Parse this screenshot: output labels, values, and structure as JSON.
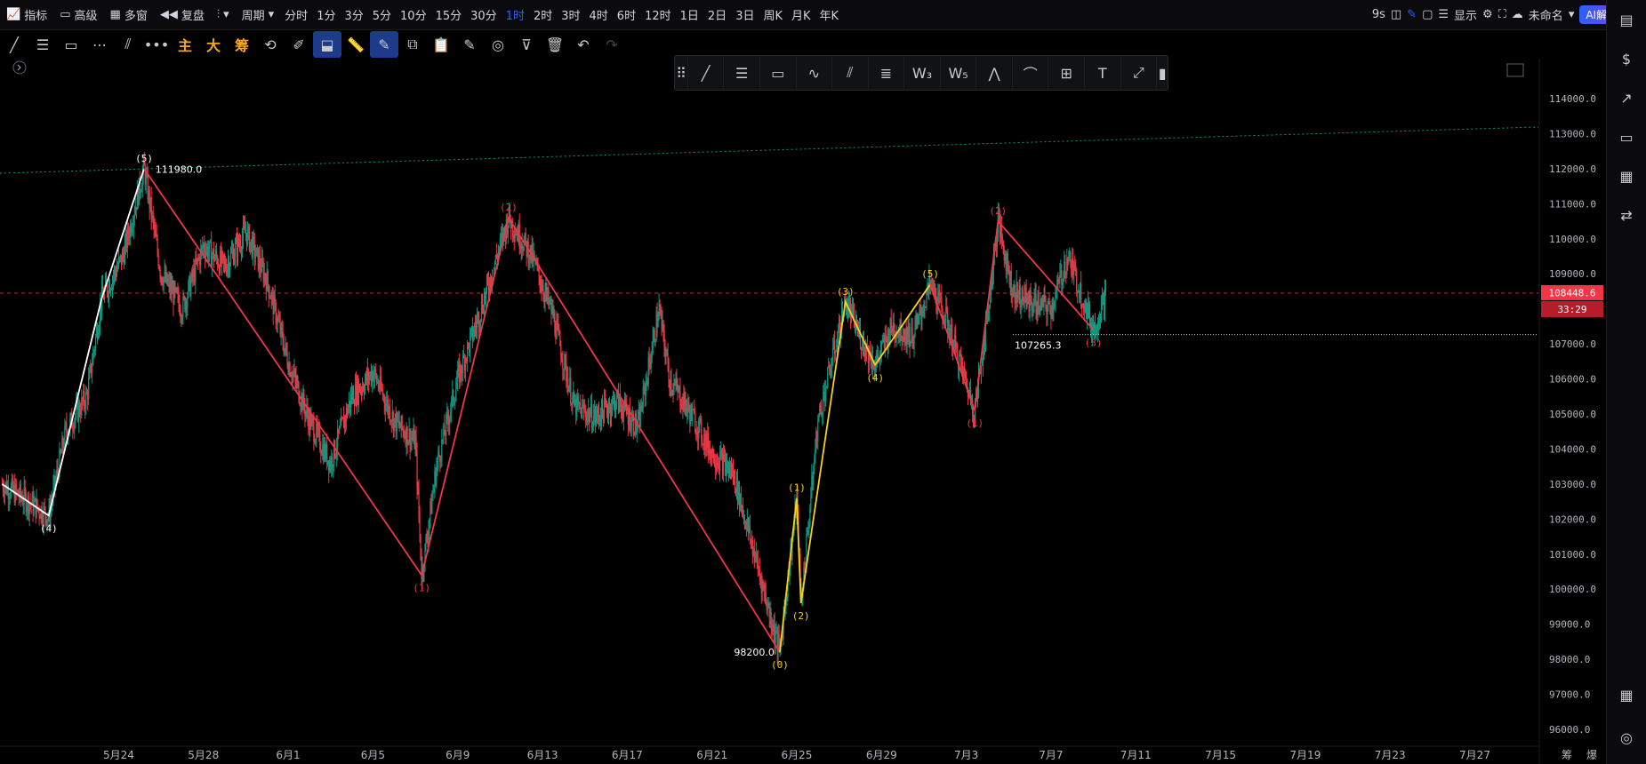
{
  "toolbar": {
    "indicator": "指标",
    "advanced": "高级",
    "multi_window": "多窗",
    "replay": "复盘",
    "period": "周期",
    "intervals": [
      "分时",
      "1分",
      "3分",
      "5分",
      "10分",
      "15分",
      "30分",
      "1时",
      "2时",
      "3时",
      "4时",
      "6时",
      "12时",
      "1日",
      "2日",
      "3日",
      "周K",
      "月K",
      "年K"
    ],
    "active_interval": "1时"
  },
  "top_right": {
    "timer": "9s",
    "display": "显示",
    "doc_name": "未命名",
    "ai": "AI解读"
  },
  "drawing_tools": {
    "main": "主",
    "big": "大",
    "chip": "筹"
  },
  "colors": {
    "up": "#089981",
    "down": "#f23645",
    "wave_red": "#f23645",
    "wave_yellow": "#f5d020",
    "wave_white": "#ffffff",
    "price_line": "#f23645"
  },
  "chart_data": {
    "type": "line",
    "title": "",
    "y_ticks": [
      96000.0,
      97000.0,
      98000.0,
      99000.0,
      100000.0,
      101000.0,
      102000.0,
      103000.0,
      104000.0,
      105000.0,
      106000.0,
      107000.0,
      108000.0,
      109000.0,
      110000.0,
      111000.0,
      112000.0,
      113000.0,
      114000.0
    ],
    "y_tick_labels": [
      "96000.0",
      "97000.0",
      "98000.0",
      "99000.0",
      "100000.0",
      "101000.0",
      "102000.0",
      "103000.0",
      "104000.0",
      "105000.0",
      "106000.0",
      "107000.0",
      "108000.0",
      "109000.0",
      "110000.0",
      "111000.0",
      "112000.0",
      "113000.0",
      "114000.0"
    ],
    "ylim": [
      96000,
      114000
    ],
    "x_ticks": [
      "5月24",
      "5月28",
      "6月1",
      "6月5",
      "6月9",
      "6月13",
      "6月17",
      "6月21",
      "6月25",
      "6月29",
      "7月3",
      "7月7",
      "7月11",
      "7月15",
      "7月19",
      "7月23",
      "7月27"
    ],
    "x_tick_day_index": [
      4,
      8,
      12,
      16,
      20,
      24,
      28,
      32,
      36,
      40,
      44,
      48,
      52,
      56,
      60,
      64,
      68
    ],
    "xlim_day_index": [
      -1.6,
      71.0
    ],
    "x_corner_labels": [
      "筹",
      "爆"
    ],
    "grid": false,
    "current_price": 108448.6,
    "current_price_label": "108448.6",
    "countdown": "33:29",
    "annotations": [
      {
        "text": "111980.0",
        "x": 5.4,
        "y": 111980.0
      },
      {
        "text": "98200.0",
        "x": 35.2,
        "y": 98200.0
      },
      {
        "text": "107265.3",
        "x": 46.2,
        "y": 107265.3
      }
    ],
    "horizontal_levels": [
      {
        "y": 107265.3,
        "from_x": 46.2,
        "style": "dotted"
      }
    ],
    "trend_line": {
      "x": [
        -1.6,
        71.0
      ],
      "y": [
        111870,
        113190
      ]
    },
    "series": [
      {
        "color": "white",
        "points": [
          {
            "x": -1.5,
            "y": 103000
          },
          {
            "x": 0.7,
            "y": 102100
          },
          {
            "x": 3.2,
            "y": 108300
          },
          {
            "x": 5.2,
            "y": 112000
          }
        ],
        "labels": [
          {
            "text": "(4)",
            "x": 0.7,
            "y": 102100,
            "pos": "below"
          },
          {
            "text": "(5)",
            "x": 5.2,
            "y": 112000,
            "pos": "above"
          }
        ]
      },
      {
        "color": "red",
        "points": [
          {
            "x": 5.2,
            "y": 112000
          },
          {
            "x": 18.3,
            "y": 100400
          },
          {
            "x": 22.4,
            "y": 110600
          },
          {
            "x": 35.2,
            "y": 98200
          }
        ],
        "labels": [
          {
            "text": "(1)",
            "x": 18.3,
            "y": 100400,
            "pos": "below"
          },
          {
            "text": "(2)",
            "x": 22.4,
            "y": 110600,
            "pos": "above"
          }
        ]
      },
      {
        "color": "yellow",
        "points": [
          {
            "x": 35.2,
            "y": 98200
          },
          {
            "x": 36.0,
            "y": 102600
          },
          {
            "x": 36.2,
            "y": 99600
          },
          {
            "x": 38.3,
            "y": 108200
          },
          {
            "x": 39.7,
            "y": 106400
          },
          {
            "x": 42.3,
            "y": 108700
          }
        ],
        "labels": [
          {
            "text": "(0)",
            "x": 35.2,
            "y": 98200,
            "pos": "below"
          },
          {
            "text": "(1)",
            "x": 36.0,
            "y": 102600,
            "pos": "above"
          },
          {
            "text": "(2)",
            "x": 36.2,
            "y": 99600,
            "pos": "below"
          },
          {
            "text": "(3)",
            "x": 38.3,
            "y": 108200,
            "pos": "above"
          },
          {
            "text": "(4)",
            "x": 39.7,
            "y": 106400,
            "pos": "below"
          },
          {
            "text": "(5)",
            "x": 42.3,
            "y": 108700,
            "pos": "above"
          }
        ]
      },
      {
        "color": "red",
        "points": [
          {
            "x": 42.3,
            "y": 108700
          },
          {
            "x": 44.4,
            "y": 105100
          },
          {
            "x": 45.5,
            "y": 110500
          },
          {
            "x": 50.0,
            "y": 107400
          }
        ],
        "labels": [
          {
            "text": "(1)",
            "x": 44.4,
            "y": 105100,
            "pos": "below"
          },
          {
            "text": "(2)",
            "x": 45.5,
            "y": 110500,
            "pos": "above"
          },
          {
            "text": "(3)",
            "x": 50.0,
            "y": 107400,
            "pos": "below"
          }
        ]
      }
    ],
    "price_path": [
      [
        -1.5,
        103000
      ],
      [
        0.7,
        102100
      ],
      [
        1.5,
        104500
      ],
      [
        2.5,
        105500
      ],
      [
        3.2,
        108300
      ],
      [
        4.2,
        109500
      ],
      [
        5.2,
        112000
      ],
      [
        6,
        109000
      ],
      [
        7,
        108000
      ],
      [
        8,
        109800
      ],
      [
        9,
        109200
      ],
      [
        10,
        110200
      ],
      [
        11,
        108800
      ],
      [
        12,
        106500
      ],
      [
        13,
        104800
      ],
      [
        14,
        103600
      ],
      [
        15,
        105500
      ],
      [
        16,
        106200
      ],
      [
        17,
        104800
      ],
      [
        18,
        104200
      ],
      [
        18.3,
        100400
      ],
      [
        19,
        103500
      ],
      [
        20,
        106000
      ],
      [
        21,
        107800
      ],
      [
        22.4,
        110600
      ],
      [
        23.5,
        109500
      ],
      [
        24.5,
        107800
      ],
      [
        25.5,
        105200
      ],
      [
        26.5,
        104900
      ],
      [
        27.5,
        105400
      ],
      [
        28.5,
        104600
      ],
      [
        29.5,
        108000
      ],
      [
        30,
        106000
      ],
      [
        31,
        105000
      ],
      [
        32,
        103900
      ],
      [
        33,
        103300
      ],
      [
        34,
        101000
      ],
      [
        35.2,
        98200
      ],
      [
        36,
        102600
      ],
      [
        36.2,
        99600
      ],
      [
        37,
        104800
      ],
      [
        38.3,
        108200
      ],
      [
        39,
        107200
      ],
      [
        39.7,
        106400
      ],
      [
        40.5,
        107500
      ],
      [
        41.5,
        107200
      ],
      [
        42.3,
        108700
      ],
      [
        43,
        107800
      ],
      [
        44.4,
        105100
      ],
      [
        45,
        107800
      ],
      [
        45.5,
        110500
      ],
      [
        46.2,
        108500
      ],
      [
        47,
        108200
      ],
      [
        48,
        108000
      ],
      [
        48.8,
        109500
      ],
      [
        49.5,
        108300
      ],
      [
        50.0,
        107400
      ],
      [
        50.6,
        108448.6
      ]
    ]
  }
}
